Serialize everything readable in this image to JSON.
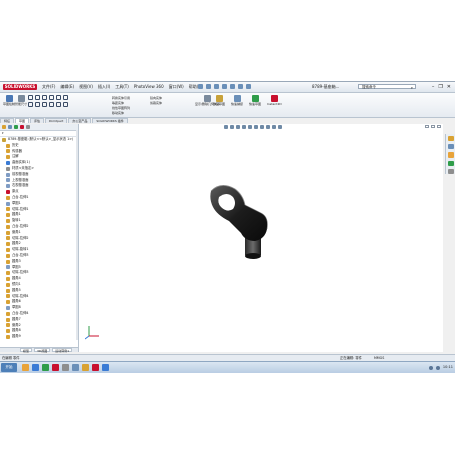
{
  "app": {
    "logo_text": "SOLIDWORKS",
    "document_title": "8789-基座箱...",
    "search_placeholder": "搜索命令"
  },
  "menu": [
    "文件(F)",
    "编辑(E)",
    "视图(V)",
    "插入(I)",
    "工具(T)",
    "PhotoView 360",
    "窗口(W)",
    "帮助(H)"
  ],
  "window_controls": {
    "minimize": "–",
    "restore": "❐",
    "close": "✕"
  },
  "toolbar": {
    "tools": [
      {
        "label": "草图绘制",
        "color": "#4a78b5"
      },
      {
        "label": "智能尺寸",
        "color": "#7a8a9c"
      }
    ],
    "tools_right": [
      {
        "label": "显示/删除几何关系",
        "color": "#7a8a9c"
      },
      {
        "label": "修复草图",
        "color": "#c8a23a"
      },
      {
        "label": "快速捕捉",
        "color": "#6a8fb8"
      },
      {
        "label": "快速草图",
        "color": "#2f9d4a"
      },
      {
        "label": "Instant2D",
        "color": "#c8102e"
      }
    ],
    "list_items": [
      "转换实体引用",
      "等距实体",
      "线性草图阵列",
      "移动实体"
    ],
    "list_items_2": [
      "镜向实体",
      "剪裁实体"
    ]
  },
  "command_tabs": [
    "特征",
    "草图",
    "评估",
    "DimXpert",
    "办公室产品",
    "SOLIDWORKS 插件"
  ],
  "feature_tree": {
    "filter": "▾",
    "root": "8789-基座箱 (默认<<默认>_显示状态 1>)",
    "items": [
      {
        "label": "历史",
        "color": "#d9a233"
      },
      {
        "label": "传感器",
        "color": "#d9a233"
      },
      {
        "label": "注解",
        "color": "#d9a233"
      },
      {
        "label": "曲面实体(1)",
        "color": "#3a7bd5"
      },
      {
        "label": "材质<未指定>",
        "color": "#8e8e8e"
      },
      {
        "label": "前视基准面",
        "color": "#7f9cc4"
      },
      {
        "label": "上视基准面",
        "color": "#7f9cc4"
      },
      {
        "label": "右视基准面",
        "color": "#7f9cc4"
      },
      {
        "label": "原点",
        "color": "#c8102e"
      },
      {
        "label": "凸台-拉伸1",
        "color": "#d9a233"
      },
      {
        "label": "草图1",
        "color": "#7f9cc4"
      },
      {
        "label": "切除-拉伸1",
        "color": "#d9a233"
      },
      {
        "label": "圆角1",
        "color": "#d9a233"
      },
      {
        "label": "旋转1",
        "color": "#d9a233"
      },
      {
        "label": "凸台-拉伸2",
        "color": "#d9a233"
      },
      {
        "label": "倒角1",
        "color": "#d9a233"
      },
      {
        "label": "切除-拉伸2",
        "color": "#d9a233"
      },
      {
        "label": "圆角2",
        "color": "#d9a233"
      },
      {
        "label": "切除-旋转1",
        "color": "#d9a233"
      },
      {
        "label": "凸台-拉伸3",
        "color": "#d9a233"
      },
      {
        "label": "圆角3",
        "color": "#d9a233"
      },
      {
        "label": "草图5",
        "color": "#7f9cc4"
      },
      {
        "label": "切除-拉伸3",
        "color": "#d9a233"
      },
      {
        "label": "圆角4",
        "color": "#d9a233"
      },
      {
        "label": "镜向1",
        "color": "#d9a233"
      },
      {
        "label": "圆角5",
        "color": "#d9a233"
      },
      {
        "label": "切除-拉伸4",
        "color": "#d9a233"
      },
      {
        "label": "圆角6",
        "color": "#d9a233"
      },
      {
        "label": "草图8",
        "color": "#7f9cc4"
      },
      {
        "label": "凸台-拉伸4",
        "color": "#d9a233"
      },
      {
        "label": "圆角7",
        "color": "#d9a233"
      },
      {
        "label": "倒角2",
        "color": "#d9a233"
      },
      {
        "label": "圆角8",
        "color": "#d9a233"
      },
      {
        "label": "圆角9",
        "color": "#d9a233"
      }
    ],
    "bottom_tabs": [
      "模型",
      "3D视图",
      "运动算例1"
    ]
  },
  "status": {
    "left": "在编辑 零件",
    "units": "MMGS",
    "edit": "正在编辑: 零件"
  },
  "taskbar": {
    "start_label": "开始",
    "clock": "10:11",
    "apps": [
      {
        "color": "#e8a33a"
      },
      {
        "color": "#3a7bd5"
      },
      {
        "color": "#2f9d4a"
      },
      {
        "color": "#c8102e"
      },
      {
        "color": "#8e8e8e"
      },
      {
        "color": "#6a8fb8"
      },
      {
        "color": "#d9a233"
      },
      {
        "color": "#c8102e"
      },
      {
        "color": "#3a7bd5"
      }
    ]
  },
  "colors": {
    "part": "#1c1c1c",
    "accent": "#c8102e"
  }
}
